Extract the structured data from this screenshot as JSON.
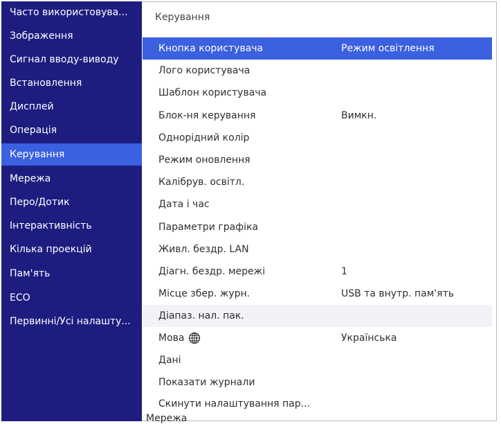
{
  "sidebar": {
    "items": [
      {
        "label": "Часто використовува..."
      },
      {
        "label": "Зображення"
      },
      {
        "label": "Сигнал вводу-виводу"
      },
      {
        "label": "Встановлення"
      },
      {
        "label": "Дисплей"
      },
      {
        "label": "Операція"
      },
      {
        "label": "Керування",
        "active": true
      },
      {
        "label": "Мережа"
      },
      {
        "label": "Перо/Дотик"
      },
      {
        "label": "Інтерактивність"
      },
      {
        "label": "Кілька проекцій"
      },
      {
        "label": "Пам'ять"
      },
      {
        "label": "ECO"
      },
      {
        "label": "Первинні/Усі налашту..."
      }
    ]
  },
  "panel": {
    "title": "Керування",
    "rows": [
      {
        "label": "Кнопка користувача",
        "value": "Режим освітлення",
        "selected": true
      },
      {
        "label": "Лого користувача",
        "value": ""
      },
      {
        "label": "Шаблон користувача",
        "value": ""
      },
      {
        "label": "Блок-ня керування",
        "value": "Вимкн."
      },
      {
        "label": "Однорідний колір",
        "value": ""
      },
      {
        "label": "Режим оновлення",
        "value": ""
      },
      {
        "label": "Калібрув. освітл.",
        "value": ""
      },
      {
        "label": "Дата і час",
        "value": ""
      },
      {
        "label": "Параметри графіка",
        "value": ""
      },
      {
        "label": "Живл. бездр. LAN",
        "value": ""
      },
      {
        "label": "Діагн. бездр. мережі",
        "value": "1"
      },
      {
        "label": "Місце збер. журн.",
        "value": "USB та внутр. пам'ять"
      },
      {
        "label": "Діапаз. нал. пак.",
        "value": ""
      },
      {
        "label": "Мова",
        "value": "Українська",
        "icon": "globe-icon"
      },
      {
        "label": "Дані",
        "value": ""
      },
      {
        "label": "Показати журнали",
        "value": ""
      },
      {
        "label": "Скинути налаштування пар...",
        "value": ""
      }
    ],
    "cutoff_label": "Мережа"
  },
  "colors": {
    "sidebar_bg": "#1d1d80",
    "selected_bg": "#3b60e0",
    "panel_bg": "#ffffff"
  }
}
